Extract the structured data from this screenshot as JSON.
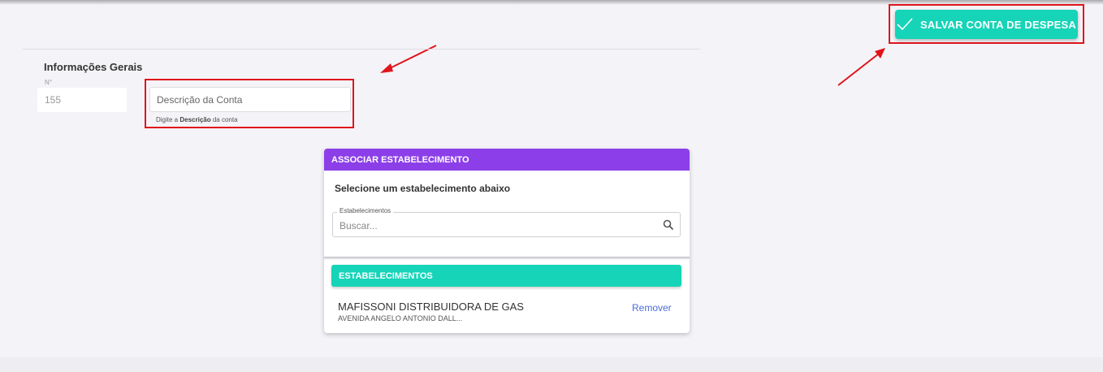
{
  "header": {
    "save_button_label": "SALVAR CONTA DE DESPESA",
    "save_icon": "check-icon"
  },
  "general_info": {
    "title": "Informações Gerais",
    "number_label": "N°",
    "number_value": "155",
    "description_placeholder": "Descrição da Conta",
    "description_value": "",
    "description_hint_prefix": "Digite a ",
    "description_hint_bold": "Descrição",
    "description_hint_suffix": " da conta"
  },
  "associate_panel": {
    "header": "ASSOCIAR ESTABELECIMENTO",
    "subtitle": "Selecione um estabelecimento abaixo",
    "search_label": "Estabelecimentos",
    "search_placeholder": "Buscar...",
    "search_value": "",
    "search_icon": "search-icon",
    "list_header": "ESTABELECIMENTOS",
    "items": [
      {
        "name": "MAFISSONI DISTRIBUIDORA DE GAS",
        "address": "AVENIDA ANGELO ANTONIO DALL...",
        "action": "Remover"
      }
    ]
  },
  "colors": {
    "accent_teal": "#16d4b8",
    "accent_purple": "#8c3fe8",
    "highlight_red": "#e0141b",
    "link_blue": "#4a6fd8"
  }
}
